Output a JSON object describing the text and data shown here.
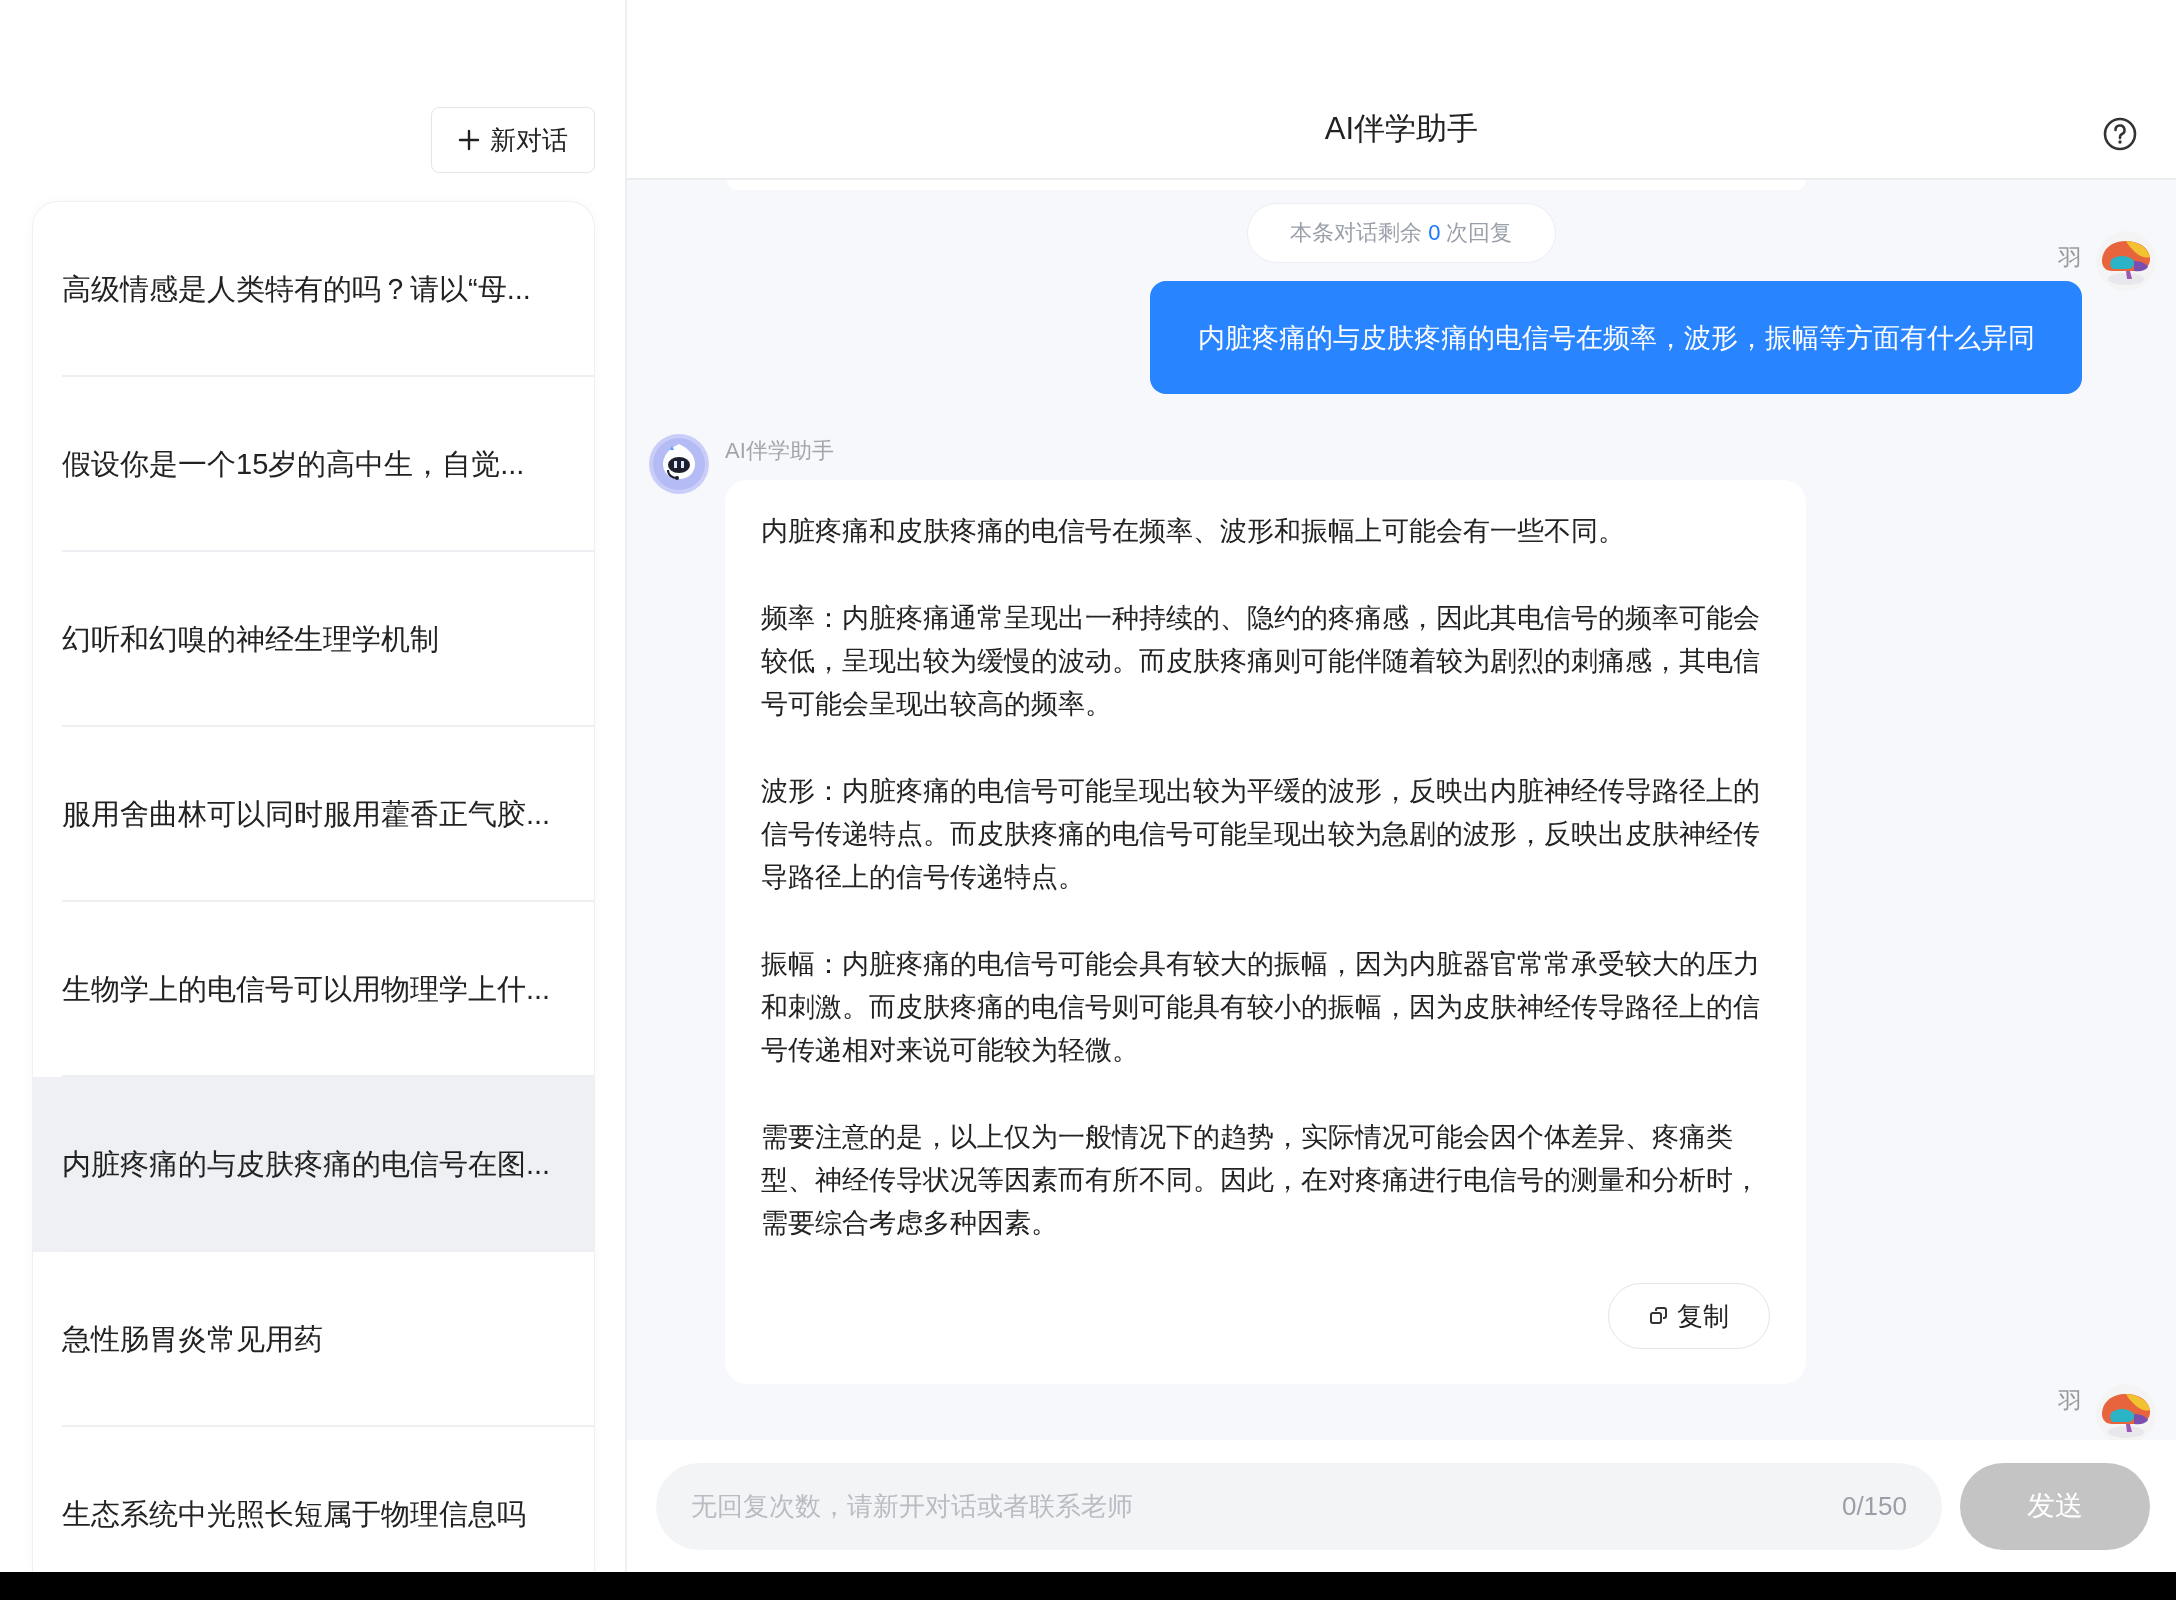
{
  "sidebar": {
    "new_chat_button": {
      "label": "新对话"
    },
    "conversations": [
      {
        "title": "高级情感是人类特有的吗？请以“母...",
        "selected": false
      },
      {
        "title": "假设你是一个15岁的高中生，自觉...",
        "selected": false
      },
      {
        "title": "幻听和幻嗅的神经生理学机制",
        "selected": false
      },
      {
        "title": "服用舍曲林可以同时服用藿香正气胶...",
        "selected": false
      },
      {
        "title": "生物学上的电信号可以用物理学上什...",
        "selected": false
      },
      {
        "title": "内脏疼痛的与皮肤疼痛的电信号在图...",
        "selected": true
      },
      {
        "title": "急性肠胃炎常见用药",
        "selected": false
      },
      {
        "title": "生态系统中光照长短属于物理信息吗",
        "selected": false
      }
    ]
  },
  "header": {
    "title": "AI伴学助手"
  },
  "notice": {
    "before": "本条对话剩余",
    "count": "0",
    "after": "次回复"
  },
  "messages": [
    {
      "kind": "user",
      "sender": "羽",
      "text": "内脏疼痛的与皮肤疼痛的电信号在频率，波形，振幅等方面有什么异同"
    },
    {
      "kind": "assistant",
      "sender": "AI伴学助手",
      "paragraphs": [
        "内脏疼痛和皮肤疼痛的电信号在频率、波形和振幅上可能会有一些不同。",
        "频率：内脏疼痛通常呈现出一种持续的、隐约的疼痛感，因此其电信号的频率可能会较低，呈现出较为缓慢的波动。而皮肤疼痛则可能伴随着较为剧烈的刺痛感，其电信号可能会呈现出较高的频率。",
        "波形：内脏疼痛的电信号可能呈现出较为平缓的波形，反映出内脏神经传导路径上的信号传递特点。而皮肤疼痛的电信号可能呈现出较为急剧的波形，反映出皮肤神经传导路径上的信号传递特点。",
        "振幅：内脏疼痛的电信号可能会具有较大的振幅，因为内脏器官常常承受较大的压力和刺激。而皮肤疼痛的电信号则可能具有较小的振幅，因为皮肤神经传导路径上的信号传递相对来说可能较为轻微。",
        "需要注意的是，以上仅为一般情况下的趋势，实际情况可能会因个体差异、疼痛类型、神经传导状况等因素而有所不同。因此，在对疼痛进行电信号的测量和分析时，需要综合考虑多种因素。"
      ],
      "copy_button": "复制"
    },
    {
      "kind": "user",
      "sender": "羽"
    }
  ],
  "composer": {
    "placeholder": "无回复次数，请新开对话或者联系老师",
    "counter": "0/150",
    "send_button": {
      "label": "发送",
      "disabled": true
    }
  }
}
